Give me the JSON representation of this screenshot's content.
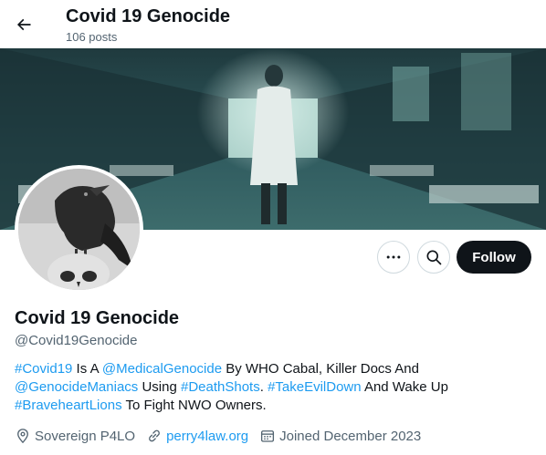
{
  "header": {
    "title": "Covid 19 Genocide",
    "posts": "106 posts"
  },
  "icons": {
    "back": "arrow-left-icon",
    "more": "more-horizontal-icon",
    "search": "search-icon",
    "location": "location-pin-icon",
    "website": "link-icon",
    "joined": "calendar-icon"
  },
  "actions": {
    "follow_label": "Follow"
  },
  "profile": {
    "name": "Covid 19 Genocide",
    "handle": "@Covid19Genocide"
  },
  "bio": {
    "tag_covid19": "#Covid19",
    "text_is_a": " Is A ",
    "mention_medical": "@MedicalGenocide",
    "text_by_who": " By WHO Cabal, Killer Docs And",
    "mention_maniacs": "@GenocideManiacs",
    "text_using": " Using ",
    "tag_deathshots": "#DeathShots",
    "text_dot": ". ",
    "tag_takeevildown": "#TakeEvilDown",
    "text_wake_up": " And Wake Up",
    "tag_braveheart": "#BraveheartLions",
    "text_fight": " To Fight NWO Owners."
  },
  "meta": {
    "location": "Sovereign P4LO",
    "website": "perry4law.org",
    "joined": "Joined December 2023"
  },
  "colors": {
    "accent": "#1d9bf0",
    "text": "#0f1419",
    "secondary": "#536471",
    "follow_bg": "#0f1419"
  }
}
